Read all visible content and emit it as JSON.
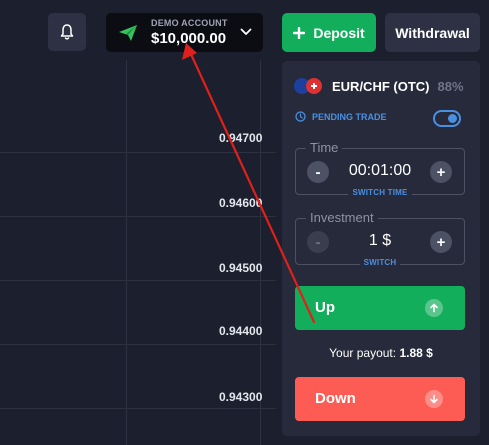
{
  "header": {
    "account_label": "DEMO ACCOUNT",
    "balance": "$10,000.00",
    "deposit_label": "Deposit",
    "withdrawal_label": "Withdrawal"
  },
  "chart": {
    "price_labels": [
      "0.94700",
      "0.94600",
      "0.94500",
      "0.94400",
      "0.94300"
    ]
  },
  "panel": {
    "asset_name": "EUR/CHF (OTC)",
    "asset_payout_pct": "88%",
    "pending_trade_label": "PENDING TRADE",
    "pending_trade_enabled": true,
    "time": {
      "legend": "Time",
      "value": "00:01:00",
      "switch_label": "SWITCH TIME",
      "minus": "-",
      "plus": "+"
    },
    "investment": {
      "legend": "Investment",
      "value": "1 $",
      "switch_label": "SWITCH",
      "minus": "-",
      "plus": "+"
    },
    "up_label": "Up",
    "payout_label": "Your payout:",
    "payout_value": "1.88 $",
    "down_label": "Down"
  },
  "colors": {
    "background": "#1c1f2d",
    "panel": "#262a3a",
    "green": "#13ae5b",
    "red": "#fd5c55",
    "accent_blue": "#4a90e2",
    "annotation_arrow": "#e0201b"
  },
  "icons": {
    "bell": "bell-icon",
    "account": "paper-plane-icon",
    "dropdown": "chevron-down-icon",
    "deposit": "plus-icon",
    "pending": "clock-icon",
    "up": "arrow-up-icon",
    "down": "arrow-down-icon"
  }
}
